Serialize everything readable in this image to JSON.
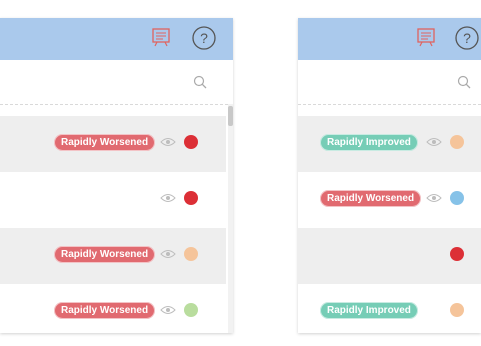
{
  "colors": {
    "header_bg": "#aac9ec",
    "worsened_badge": "#e16a70",
    "improved_badge": "#76cdb6",
    "dot_red": "#dc2f36",
    "dot_orange": "#f5c49a",
    "dot_green": "#b9dd9e",
    "dot_blue": "#86c2e8"
  },
  "icons": {
    "report": "report-icon",
    "help": "help-icon",
    "search": "search-icon",
    "eye": "eye-icon"
  },
  "left_panel": {
    "rows": [
      {
        "badge": "Rapidly Worsened",
        "dot_color": "#dc2f36"
      },
      {
        "badge": "",
        "dot_color": "#dc2f36"
      },
      {
        "badge": "Rapidly Worsened",
        "dot_color": "#f5c49a"
      },
      {
        "badge": "Rapidly Worsened",
        "dot_color": "#b9dd9e"
      }
    ]
  },
  "right_panel": {
    "rows": [
      {
        "badge": "Rapidly Improved",
        "dot_color": "#f5c49a"
      },
      {
        "badge": "Rapidly Worsened",
        "dot_color": "#86c2e8"
      },
      {
        "badge": "",
        "dot_color": "#dc2f36"
      },
      {
        "badge": "Rapidly Improved",
        "dot_color": "#f5c49a"
      }
    ]
  }
}
